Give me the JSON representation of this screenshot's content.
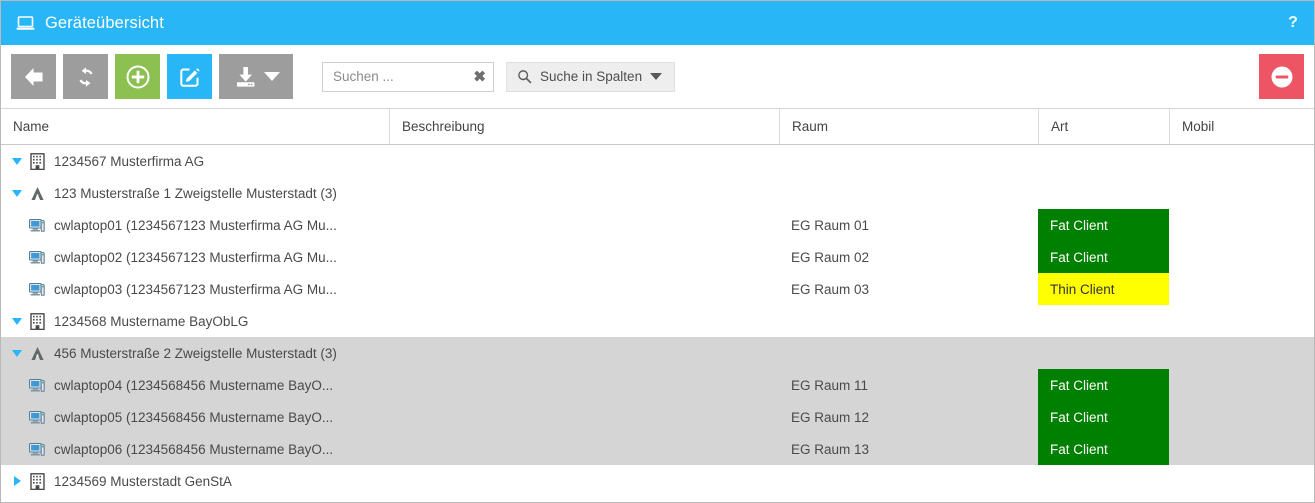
{
  "window": {
    "title": "Geräteübersicht",
    "title_icon": "laptop-icon",
    "help_label": "?",
    "accent_color": "#29b6f6"
  },
  "toolbar": {
    "buttons": [
      {
        "name": "back-button",
        "icon": "arrow-left-icon",
        "color": "#9d9d9d"
      },
      {
        "name": "refresh-button",
        "icon": "refresh-icon",
        "color": "#9d9d9d"
      },
      {
        "name": "add-button",
        "icon": "plus-circle-icon",
        "color": "#8cc152"
      },
      {
        "name": "edit-button",
        "icon": "pencil-edit-icon",
        "color": "#29b6f6"
      },
      {
        "name": "export-button",
        "icon": "download-icon",
        "color": "#9d9d9d"
      },
      {
        "name": "delete-button",
        "icon": "minus-circle-icon",
        "color": "#ed5565"
      }
    ],
    "search": {
      "placeholder": "Suchen ...",
      "value": "",
      "clear_label": "✖"
    },
    "column_search": {
      "label": "Suche in Spalten",
      "icon": "search-icon",
      "caret": "chevron-down-icon"
    }
  },
  "table": {
    "columns": [
      {
        "key": "name",
        "label": "Name"
      },
      {
        "key": "desc",
        "label": "Beschreibung"
      },
      {
        "key": "raum",
        "label": "Raum"
      },
      {
        "key": "art",
        "label": "Art"
      },
      {
        "key": "mob",
        "label": "Mobil"
      }
    ],
    "rows": [
      {
        "level": 0,
        "expander": "down",
        "icon": "building-icon",
        "name": "1234567 Musterfirma AG",
        "desc": "",
        "raum": "",
        "art": "",
        "art_color": "",
        "mob": "",
        "selected": false
      },
      {
        "level": 1,
        "expander": "down",
        "icon": "road-sign-icon",
        "name": "123 Musterstraße 1 Zweigstelle Musterstadt (3)",
        "desc": "",
        "raum": "",
        "art": "",
        "art_color": "",
        "mob": "",
        "selected": false
      },
      {
        "level": 2,
        "expander": "none",
        "icon": "computer-icon",
        "name": "cwlaptop01 (1234567123 Musterfirma AG Mu...",
        "desc": "",
        "raum": "EG Raum 01",
        "art": "Fat Client",
        "art_color": "green",
        "mob": "",
        "selected": false
      },
      {
        "level": 2,
        "expander": "none",
        "icon": "computer-icon",
        "name": "cwlaptop02 (1234567123 Musterfirma AG Mu...",
        "desc": "",
        "raum": "EG Raum 02",
        "art": "Fat Client",
        "art_color": "green",
        "mob": "",
        "selected": false
      },
      {
        "level": 2,
        "expander": "none",
        "icon": "computer-icon",
        "name": "cwlaptop03 (1234567123 Musterfirma AG Mu...",
        "desc": "",
        "raum": "EG Raum 03",
        "art": "Thin Client",
        "art_color": "yellow",
        "mob": "",
        "selected": false
      },
      {
        "level": 0,
        "expander": "down",
        "icon": "building-icon",
        "name": "1234568 Mustername BayObLG",
        "desc": "",
        "raum": "",
        "art": "",
        "art_color": "",
        "mob": "",
        "selected": false
      },
      {
        "level": 1,
        "expander": "down",
        "icon": "road-sign-icon",
        "name": "456 Musterstraße 2 Zweigstelle Musterstadt (3)",
        "desc": "",
        "raum": "",
        "art": "",
        "art_color": "",
        "mob": "",
        "selected": true
      },
      {
        "level": 2,
        "expander": "none",
        "icon": "computer-icon",
        "name": "cwlaptop04 (1234568456 Mustername BayO...",
        "desc": "",
        "raum": "EG Raum 11",
        "art": "Fat Client",
        "art_color": "green",
        "mob": "",
        "selected": true
      },
      {
        "level": 2,
        "expander": "none",
        "icon": "computer-icon",
        "name": "cwlaptop05 (1234568456 Mustername BayO...",
        "desc": "",
        "raum": "EG Raum 12",
        "art": "Fat Client",
        "art_color": "green",
        "mob": "",
        "selected": true
      },
      {
        "level": 2,
        "expander": "none",
        "icon": "computer-icon",
        "name": "cwlaptop06 (1234568456 Mustername BayO...",
        "desc": "",
        "raum": "EG Raum 13",
        "art": "Fat Client",
        "art_color": "green",
        "mob": "",
        "selected": true
      },
      {
        "level": 0,
        "expander": "right",
        "icon": "building-icon",
        "name": "1234569 Musterstadt GenStA",
        "desc": "",
        "raum": "",
        "art": "",
        "art_color": "",
        "mob": "",
        "selected": false
      }
    ]
  }
}
